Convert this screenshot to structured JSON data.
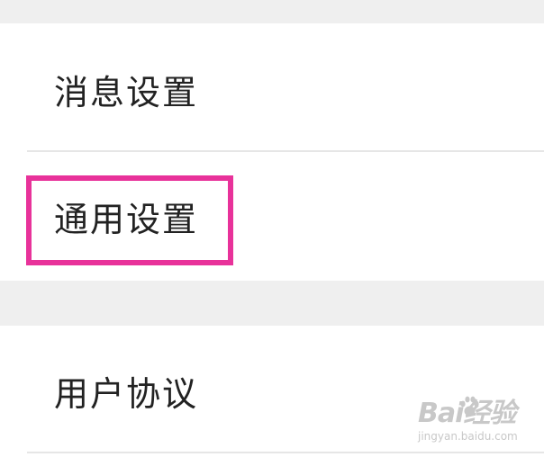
{
  "settings": {
    "items": [
      {
        "label": "消息设置"
      },
      {
        "label": "通用设置"
      },
      {
        "label": "用户协议"
      }
    ]
  },
  "watermark": {
    "logo": "Bai经验",
    "url": "jingyan.baidu.com"
  },
  "colors": {
    "highlight": "#e8329a",
    "section_gap": "#efefef",
    "text": "#222222",
    "divider": "#e6e6e6"
  }
}
